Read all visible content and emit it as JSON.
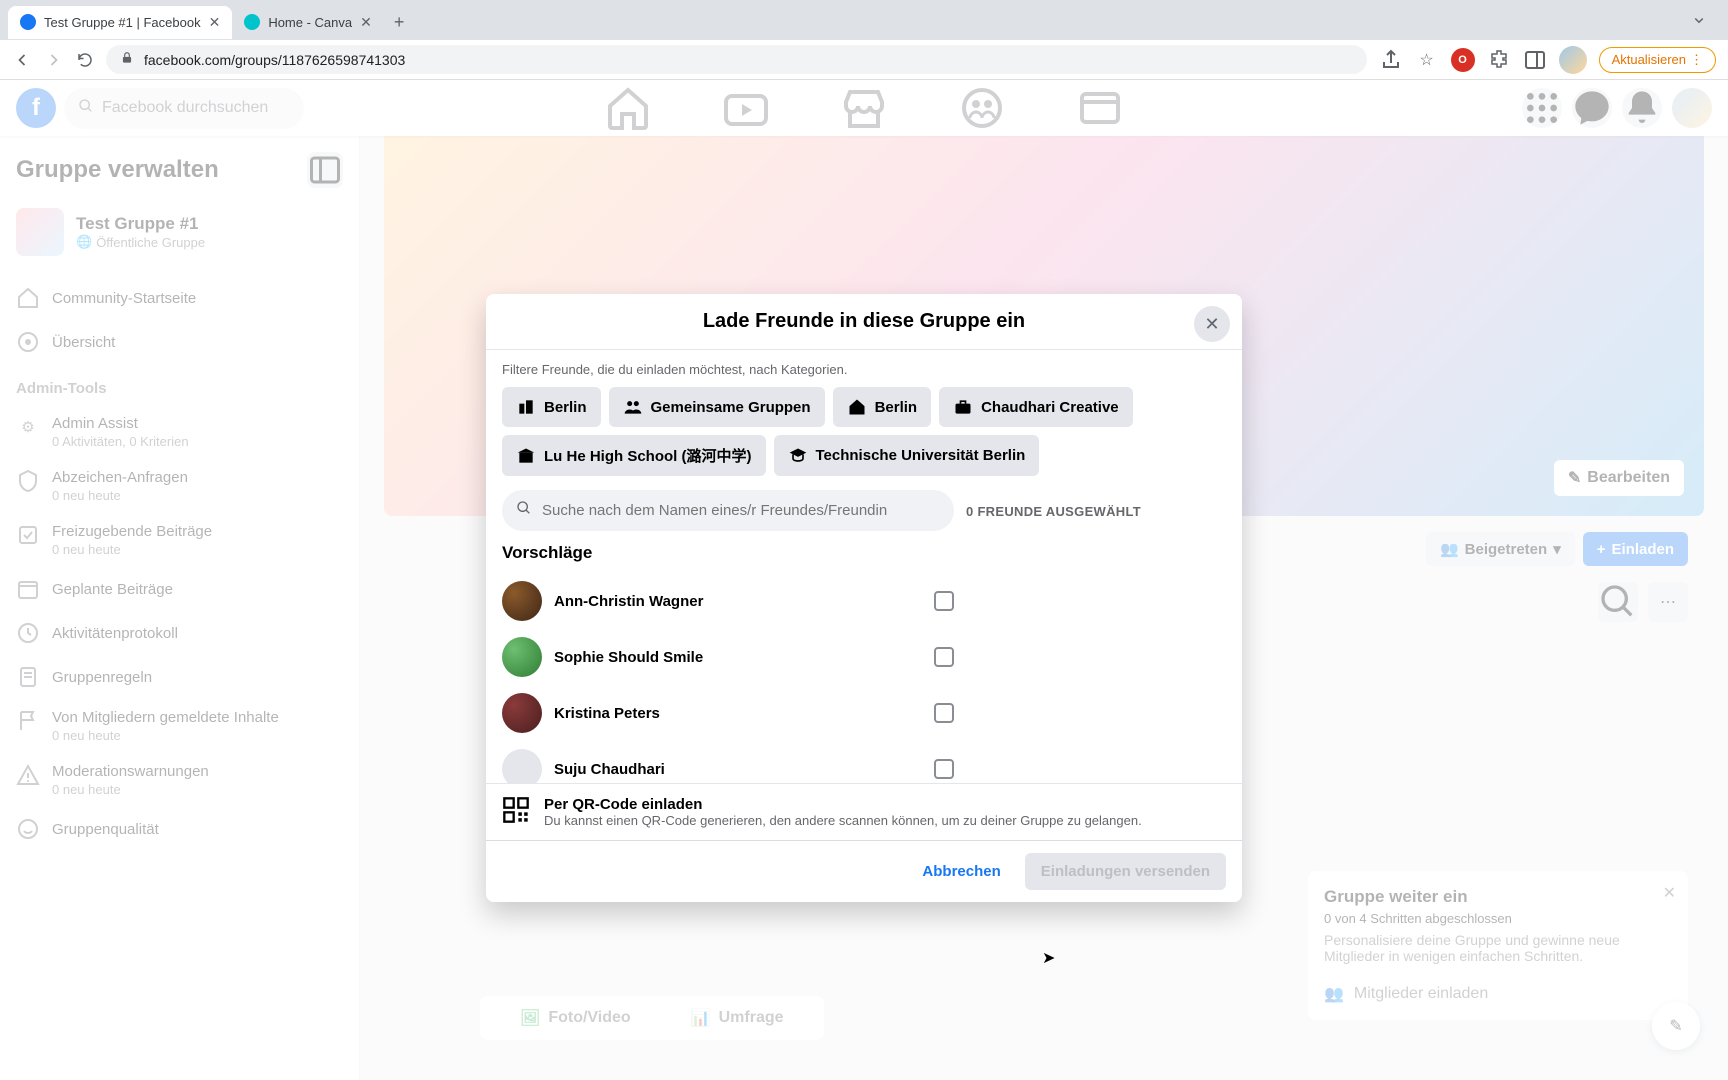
{
  "browser": {
    "tabs": [
      {
        "title": "Test Gruppe #1 | Facebook",
        "favicon": "#1877f2"
      },
      {
        "title": "Home - Canva",
        "favicon": "#00c4cc"
      }
    ],
    "url": "facebook.com/groups/1187626598741303",
    "update_label": "Aktualisieren"
  },
  "fb": {
    "search_placeholder": "Facebook durchsuchen",
    "sidebar": {
      "title": "Gruppe verwalten",
      "group_name": "Test Gruppe #1",
      "group_visibility": "Öffentliche Gruppe",
      "items": [
        {
          "label": "Community-Startseite"
        },
        {
          "label": "Übersicht"
        }
      ],
      "admin_section": "Admin-Tools",
      "admin_items": [
        {
          "label": "Admin Assist",
          "sub": "0 Aktivitäten, 0 Kriterien"
        },
        {
          "label": "Abzeichen-Anfragen",
          "sub": "0 neu heute"
        },
        {
          "label": "Freizugebende Beiträge",
          "sub": "0 neu heute"
        },
        {
          "label": "Geplante Beiträge",
          "sub": ""
        },
        {
          "label": "Aktivitätenprotokoll",
          "sub": ""
        },
        {
          "label": "Gruppenregeln",
          "sub": ""
        },
        {
          "label": "Von Mitgliedern gemeldete Inhalte",
          "sub": "0 neu heute"
        },
        {
          "label": "Moderationswarnungen",
          "sub": "0 neu heute"
        },
        {
          "label": "Gruppenqualität",
          "sub": ""
        }
      ]
    },
    "cover_edit": "Bearbeiten",
    "joined_label": "Beigetreten",
    "invite_label": "Einladen",
    "setup": {
      "title": "Gruppe weiter ein",
      "progress": "0 von 4 Schritten abgeschlossen",
      "desc": "Personalisiere deine Gruppe und gewinne neue Mitglieder in wenigen einfachen Schritten.",
      "invite_members": "Mitglieder einladen"
    },
    "composer": {
      "photo": "Foto/Video",
      "poll": "Umfrage"
    }
  },
  "modal": {
    "title": "Lade Freunde in diese Gruppe ein",
    "filter_hint": "Filtere Freunde, die du einladen möchtest, nach Kategorien.",
    "chips": [
      {
        "label": "Berlin",
        "icon": "city"
      },
      {
        "label": "Gemeinsame Gruppen",
        "icon": "groups"
      },
      {
        "label": "Berlin",
        "icon": "home"
      },
      {
        "label": "Chaudhari Creative",
        "icon": "work"
      },
      {
        "label": "Lu He High School (潞河中学)",
        "icon": "school"
      },
      {
        "label": "Technische Universität Berlin",
        "icon": "education"
      }
    ],
    "search_placeholder": "Suche nach dem Namen eines/r Freundes/Freundin",
    "selected_label": "0 FREUNDE AUSGEWÄHLT",
    "suggest_label": "Vorschläge",
    "friends": [
      {
        "name": "Ann-Christin Wagner"
      },
      {
        "name": "Sophie Should Smile"
      },
      {
        "name": "Kristina Peters"
      },
      {
        "name": "Suju Chaudhari"
      }
    ],
    "qr_title": "Per QR-Code einladen",
    "qr_desc": "Du kannst einen QR-Code generieren, den andere scannen können, um zu deiner Gruppe zu gelangen.",
    "cancel": "Abbrechen",
    "submit": "Einladungen versenden"
  }
}
